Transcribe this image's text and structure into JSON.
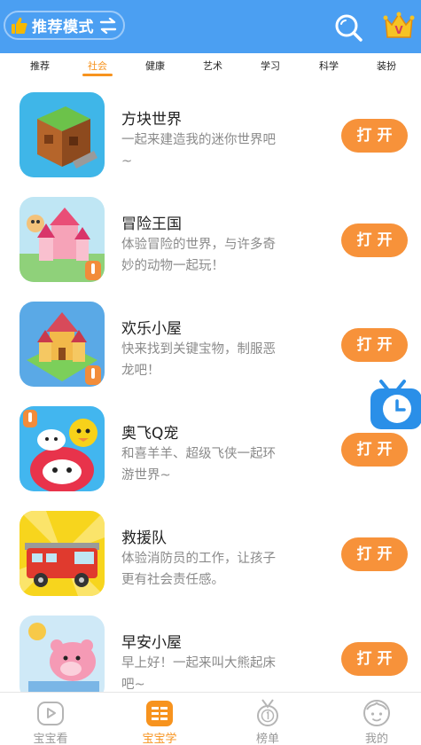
{
  "header": {
    "mode_label": "推荐模式",
    "thumb_icon": "thumbs-up-icon",
    "swap_icon": "swap-arrows-icon",
    "search_icon": "search-icon",
    "crown_icon": "vip-crown-icon",
    "crown_letter": "V",
    "background_color": "#4b9ff2"
  },
  "tabs": [
    {
      "label": "推荐",
      "active": false
    },
    {
      "label": "社会",
      "active": true
    },
    {
      "label": "健康",
      "active": false
    },
    {
      "label": "艺术",
      "active": false
    },
    {
      "label": "学习",
      "active": false
    },
    {
      "label": "科学",
      "active": false
    },
    {
      "label": "装扮",
      "active": false
    }
  ],
  "accent_color": "#f7931e",
  "apps": [
    {
      "name": "方块世界",
      "desc": "一起来建造我的迷你世界吧~",
      "button": "打开",
      "icon": "block-world-icon"
    },
    {
      "name": "冒险王国",
      "desc": "体验冒险的世界，与许多奇妙的动物一起玩！",
      "button": "打开",
      "icon": "adventure-kingdom-icon"
    },
    {
      "name": "欢乐小屋",
      "desc": "快来找到关键宝物，制服恶龙吧！",
      "button": "打开",
      "icon": "happy-house-icon"
    },
    {
      "name": "奥飞Q宠",
      "desc": "和喜羊羊、超级飞侠一起环游世界~",
      "button": "打开",
      "icon": "qpet-icon"
    },
    {
      "name": "救援队",
      "desc": "体验消防员的工作，让孩子更有社会责任感。",
      "button": "打开",
      "icon": "fire-truck-icon"
    },
    {
      "name": "早安小屋",
      "desc": "早上好！一起来叫大熊起床吧~",
      "button": "打开",
      "icon": "morning-bear-icon"
    }
  ],
  "float_icon": "tv-clock-icon",
  "bottom_nav": [
    {
      "label": "宝宝看",
      "icon": "play-tv-icon",
      "active": false
    },
    {
      "label": "宝宝学",
      "icon": "learn-book-icon",
      "active": true
    },
    {
      "label": "榜单",
      "icon": "medal-icon",
      "active": false
    },
    {
      "label": "我的",
      "icon": "profile-face-icon",
      "active": false
    }
  ]
}
